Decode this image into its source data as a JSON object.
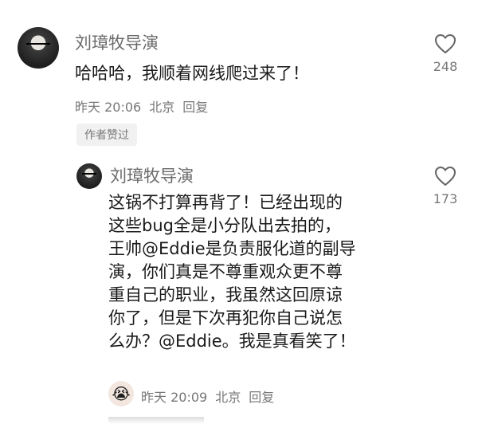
{
  "comment": {
    "author": "刘璋牧导演",
    "text": "哈哈哈，我顺着网线爬过来了！",
    "time": "昨天 20:06",
    "location": "北京",
    "reply_label": "回复",
    "likes": "248",
    "badge": "作者赞过"
  },
  "reply": {
    "author": "刘璋牧导演",
    "lines": [
      "这锅不打算再背了！已经出现的",
      "这些bug全是小分队出去拍的，",
      "王帅@Eddie是负责服化道的副导",
      "演，你们真是不尊重观众更不尊",
      "重自己的职业，我虽然这回原谅",
      "你了，但是下次再犯你自己说怎",
      "么办？@Eddie。我是真看笑了！"
    ],
    "time": "昨天 20:09",
    "location": "北京",
    "reply_label": "回复",
    "likes": "173"
  },
  "icons": {
    "like": "heart-outline-icon",
    "reply_avatar_emoji": "crying-face-icon"
  }
}
